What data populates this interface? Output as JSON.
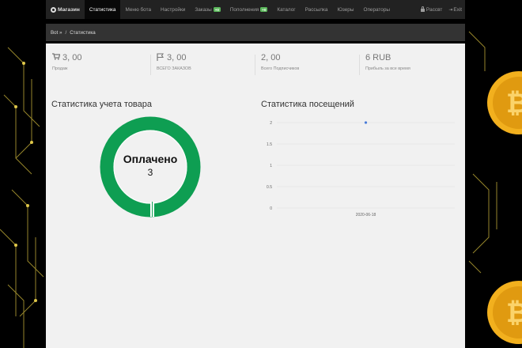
{
  "nav": {
    "brand": "Магазин",
    "items": [
      {
        "label": "Статистика",
        "active": true
      },
      {
        "label": "Меню бота"
      },
      {
        "label": "Настройки"
      },
      {
        "label": "Заказы",
        "badge": "+0"
      },
      {
        "label": "Пополнения",
        "badge": "+0"
      },
      {
        "label": "Каталог"
      },
      {
        "label": "Рассылка"
      },
      {
        "label": "Юзеры"
      },
      {
        "label": "Операторы"
      }
    ],
    "right": {
      "password": "Pассвт",
      "exit": "Exit"
    }
  },
  "breadcrumb": {
    "root": "Bot »",
    "separator": "/",
    "current": "Статистика"
  },
  "stats": [
    {
      "icon": "cart-icon",
      "value": "3, 00",
      "label": "Продаж"
    },
    {
      "icon": "flag-icon",
      "value": "3, 00",
      "label": "ВСЕГО ЗАКАЗОВ"
    },
    {
      "icon": "",
      "value": "2, 00",
      "label": "Всего Подписчиков"
    },
    {
      "icon": "",
      "value": "6 RUB",
      "label": "Прибыль за все время"
    }
  ],
  "donut": {
    "title": "Статистика учета товара",
    "center_label": "Оплачено",
    "center_value": "3",
    "color": "#0e9e52"
  },
  "visits": {
    "title": "Статистика посещений"
  },
  "chart_data": {
    "type": "line",
    "x": [
      "2020-06-18"
    ],
    "series": [
      {
        "values": [
          2
        ],
        "color": "#4a7cd9"
      }
    ],
    "yticks": [
      "2",
      "1.5",
      "1",
      "0.5",
      "0"
    ],
    "ylim": [
      0,
      2
    ],
    "grid": true
  }
}
